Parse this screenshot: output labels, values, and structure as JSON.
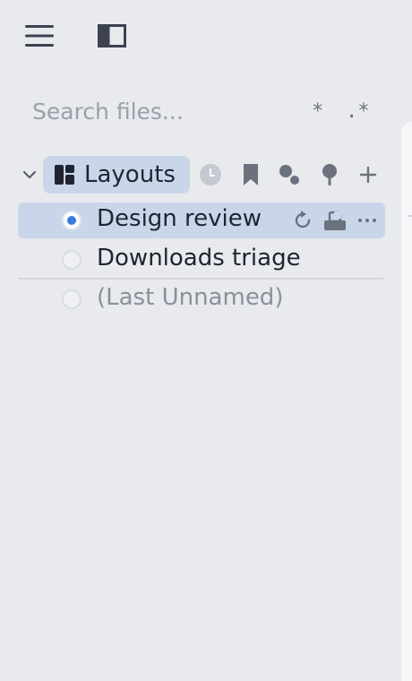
{
  "colors": {
    "background": "#e8eaee",
    "selection": "#c9d6ea",
    "radio_on": "#3b7be0",
    "text": "#1f2430",
    "muted_text": "#8a909b"
  },
  "topbar": {
    "menu_icon": "hamburger-menu-icon",
    "sidebar_icon": "sidebar-toggle-icon"
  },
  "search": {
    "placeholder": "Search files...",
    "value": "",
    "glob_option": "*",
    "regex_option": ".*"
  },
  "section": {
    "title": "Layouts",
    "icon": "layout-grid-icon",
    "actions": [
      "clock-icon",
      "bookmark-icon",
      "tag-dots-icon",
      "pin-icon",
      "plus-icon"
    ]
  },
  "layouts": [
    {
      "label": "Design review",
      "selected": true,
      "muted": false
    },
    {
      "label": "Downloads triage",
      "selected": false,
      "muted": false
    },
    {
      "label": "(Last Unnamed)",
      "selected": false,
      "muted": true
    }
  ],
  "row_actions": [
    "refresh-icon",
    "save-layout-icon",
    "more-options-icon"
  ]
}
